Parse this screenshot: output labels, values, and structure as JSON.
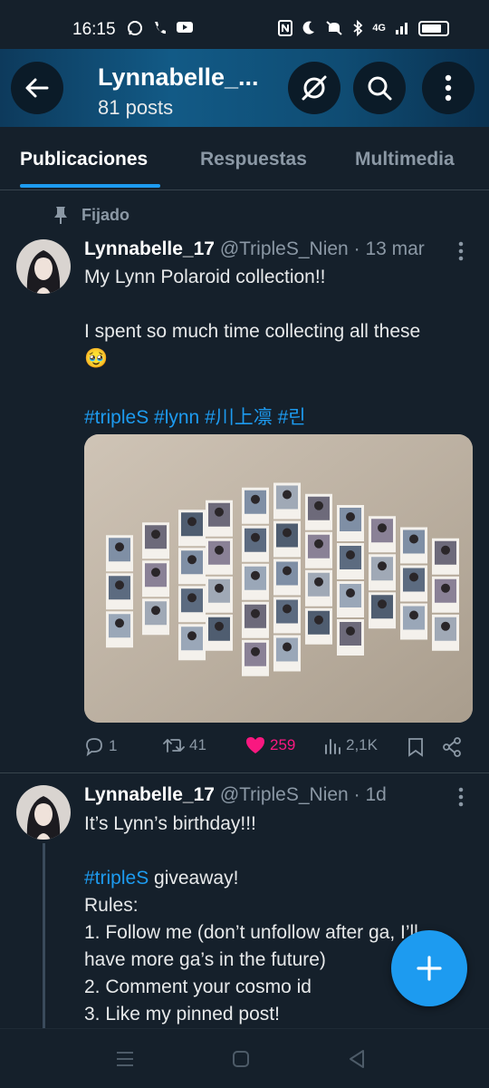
{
  "status": {
    "time": "16:15",
    "network": "4G"
  },
  "header": {
    "title": "Lynnabelle_...",
    "subtitle": "81 posts"
  },
  "tabs": [
    {
      "label": "Publicaciones",
      "active": true
    },
    {
      "label": "Respuestas",
      "active": false
    },
    {
      "label": "Multimedia",
      "active": false
    }
  ],
  "pinned_label": "Fijado",
  "tweet1": {
    "name": "Lynnabelle_17",
    "handle": "@TripleS_Nien",
    "sep": "·",
    "date": "13 mar",
    "line1": "My Lynn Polaroid collection!!",
    "line2": "I spent so much time collecting all these",
    "emoji": "🥹",
    "hashtags": "#tripleS #lynn #川上凛 #린",
    "replies": "1",
    "retweets": "41",
    "likes": "259",
    "views": "2,1K"
  },
  "tweet2": {
    "name": "Lynnabelle_17",
    "handle": "@TripleS_Nien",
    "sep": "·",
    "date": "1d",
    "line1": "It’s Lynn’s birthday!!!",
    "hashtag": "#tripleS",
    "line2_rest": " giveaway!",
    "line3": "Rules:",
    "line4": "1. Follow me (don’t unfollow after ga, I’ll",
    "line5": "have more ga’s in the future)",
    "line6": "2. Comment your cosmo id",
    "line7": "3. Like my pinned post!"
  },
  "colors": {
    "background": "#15202b",
    "accent": "#1d9bf0",
    "like": "#f91880",
    "muted": "#8b98a5"
  }
}
